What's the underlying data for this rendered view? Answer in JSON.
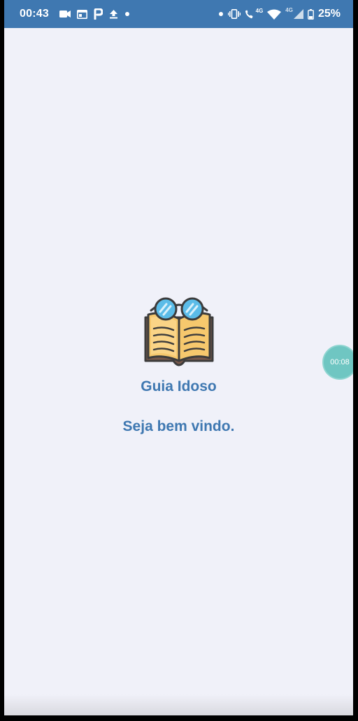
{
  "status_bar": {
    "time": "00:43",
    "network_label_1": "4G",
    "network_label_2": "4G",
    "battery": "25%",
    "icons_left": [
      "video-camera-icon",
      "window-icon",
      "p-icon",
      "upload-icon",
      "dot-icon"
    ],
    "icons_right": [
      "dot-icon",
      "vibrate-icon",
      "call-icon",
      "wifi-icon",
      "signal-icon",
      "battery-icon"
    ],
    "background": "#3f78b1"
  },
  "app": {
    "logo_icon": "open-book-with-glasses-icon",
    "title": "Guia Idoso",
    "welcome": "Seja bem vindo."
  },
  "recorder": {
    "elapsed": "00:08",
    "color": "#6fc6c2"
  },
  "theme": {
    "accent": "#3f78b1",
    "background": "#f0f1f9"
  }
}
